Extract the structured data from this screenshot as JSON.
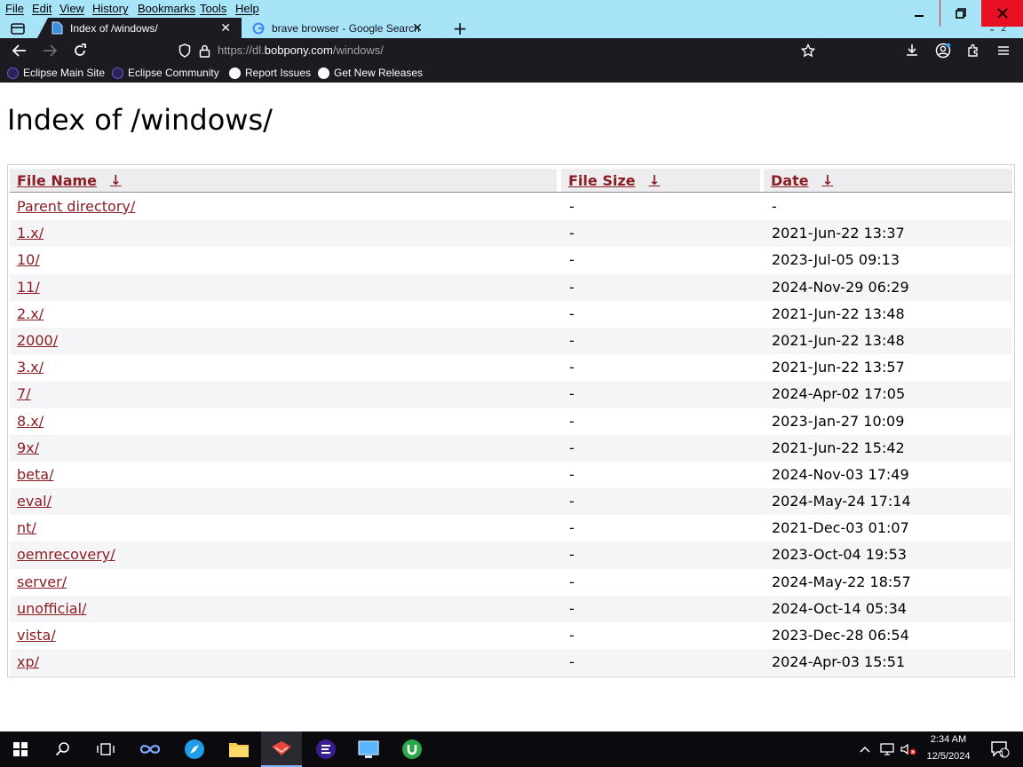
{
  "menu": [
    "File",
    "Edit",
    "View",
    "History",
    "Bookmarks",
    "Tools",
    "Help"
  ],
  "tabs": [
    {
      "label": "Index of /windows/",
      "active": true
    },
    {
      "label": "brave browser - Google Search",
      "active": false
    }
  ],
  "tab_overflow_count": "2",
  "url": {
    "prefix": "https://dl.",
    "domain": "bobpony.com",
    "path": "/windows/"
  },
  "bookmarks": [
    {
      "label": "Eclipse Main Site",
      "icon": "eclipse-icon"
    },
    {
      "label": "Eclipse Community",
      "icon": "eclipse-icon"
    },
    {
      "label": "Report Issues",
      "icon": "github-icon"
    },
    {
      "label": "Get New Releases",
      "icon": "github-icon"
    }
  ],
  "page": {
    "title": "Index of /windows/",
    "headers": {
      "name": "File Name",
      "size": "File Size",
      "date": "Date",
      "sort_arrow": "↓"
    },
    "rows": [
      {
        "name": "Parent directory/",
        "size": "-",
        "date": "-"
      },
      {
        "name": "1.x/",
        "size": "-",
        "date": "2021-Jun-22 13:37"
      },
      {
        "name": "10/",
        "size": "-",
        "date": "2023-Jul-05 09:13"
      },
      {
        "name": "11/",
        "size": "-",
        "date": "2024-Nov-29 06:29"
      },
      {
        "name": "2.x/",
        "size": "-",
        "date": "2021-Jun-22 13:48"
      },
      {
        "name": "2000/",
        "size": "-",
        "date": "2021-Jun-22 13:48"
      },
      {
        "name": "3.x/",
        "size": "-",
        "date": "2021-Jun-22 13:57"
      },
      {
        "name": "7/",
        "size": "-",
        "date": "2024-Apr-02 17:05"
      },
      {
        "name": "8.x/",
        "size": "-",
        "date": "2023-Jan-27 10:09"
      },
      {
        "name": "9x/",
        "size": "-",
        "date": "2021-Jun-22 15:42"
      },
      {
        "name": "beta/",
        "size": "-",
        "date": "2024-Nov-03 17:49"
      },
      {
        "name": "eval/",
        "size": "-",
        "date": "2024-May-24 17:14"
      },
      {
        "name": "nt/",
        "size": "-",
        "date": "2021-Dec-03 01:07"
      },
      {
        "name": "oemrecovery/",
        "size": "-",
        "date": "2023-Oct-04 19:53"
      },
      {
        "name": "server/",
        "size": "-",
        "date": "2024-May-22 18:57"
      },
      {
        "name": "unofficial/",
        "size": "-",
        "date": "2024-Oct-14 05:34"
      },
      {
        "name": "vista/",
        "size": "-",
        "date": "2023-Dec-28 06:54"
      },
      {
        "name": "xp/",
        "size": "-",
        "date": "2024-Apr-03 15:51"
      }
    ]
  },
  "taskbar": {
    "icons": [
      "windows-start-icon",
      "search-icon",
      "task-view-icon",
      "infinity-app-icon",
      "safari-like-icon",
      "file-explorer-icon",
      "folder-app-icon",
      "eclipse-icon",
      "remote-desktop-icon",
      "utorrent-icon"
    ],
    "time": "2:34 AM",
    "date": "12/5/2024",
    "notification_count": "1"
  },
  "colors": {
    "link": "#8b1e24",
    "tabstrip": "#a8e4f8",
    "toolbar": "#1c1b22",
    "close": "#e81123"
  }
}
